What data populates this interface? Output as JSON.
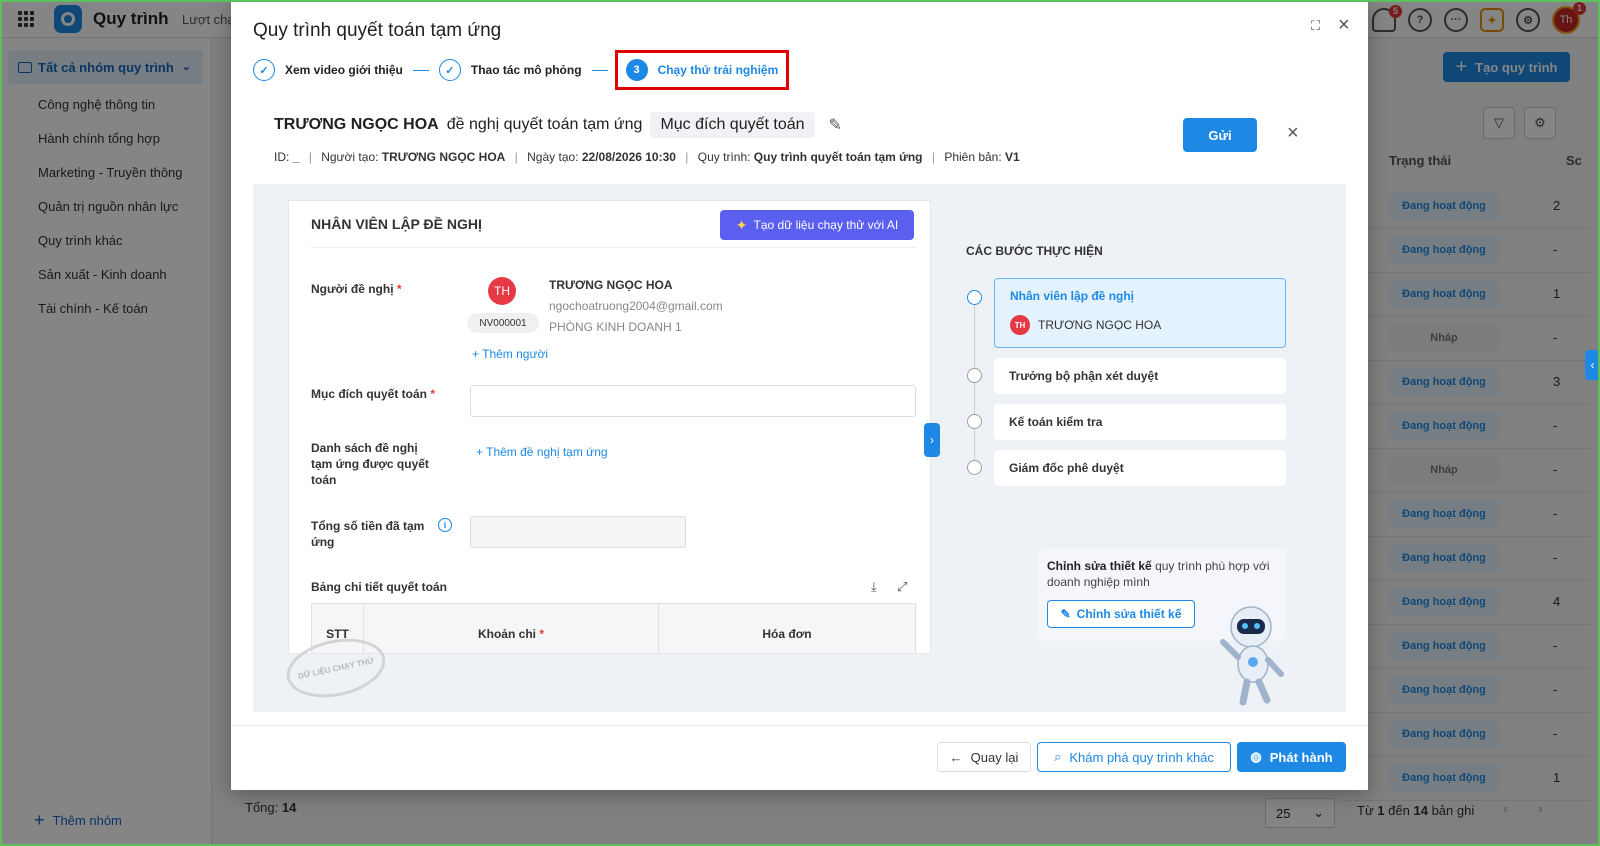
{
  "app": {
    "title": "Quy trình",
    "nav_tab": "Lượt chạ",
    "user_initials": "Th",
    "notif_count": "5",
    "avatar_badge": "1"
  },
  "sidebar": {
    "group_label": "Tất cả nhóm quy trình",
    "items": [
      {
        "label": "Công nghệ thông tin"
      },
      {
        "label": "Hành chính tổng hợp"
      },
      {
        "label": "Marketing - Truyền thông"
      },
      {
        "label": "Quản trị nguồn nhân lực"
      },
      {
        "label": "Quy trình khác"
      },
      {
        "label": "Sản xuất - Kinh doanh"
      },
      {
        "label": "Tài chính - Kế toán"
      }
    ],
    "add_group": "Thêm nhóm"
  },
  "background": {
    "create_button": "Tạo quy trình",
    "col_status": "Trạng thái",
    "col_s": "Sc",
    "rows": [
      {
        "status": "Đang hoạt động",
        "draft": false,
        "count": "2"
      },
      {
        "status": "Đang hoạt động",
        "draft": false,
        "count": "-"
      },
      {
        "status": "Đang hoạt động",
        "draft": false,
        "count": "1"
      },
      {
        "status": "Nháp",
        "draft": true,
        "count": "-"
      },
      {
        "status": "Đang hoạt động",
        "draft": false,
        "count": "3"
      },
      {
        "status": "Đang hoạt động",
        "draft": false,
        "count": "-"
      },
      {
        "status": "Nháp",
        "draft": true,
        "count": "-"
      },
      {
        "status": "Đang hoạt động",
        "draft": false,
        "count": "-"
      },
      {
        "status": "Đang hoạt động",
        "draft": false,
        "count": "-"
      },
      {
        "status": "Đang hoạt động",
        "draft": false,
        "count": "4"
      },
      {
        "status": "Đang hoạt động",
        "draft": false,
        "count": "-"
      },
      {
        "status": "Đang hoạt động",
        "draft": false,
        "count": "-"
      },
      {
        "status": "Đang hoạt động",
        "draft": false,
        "count": "-"
      },
      {
        "status": "Đang hoạt động",
        "draft": false,
        "count": "1"
      }
    ],
    "total_label": "Tổng:",
    "total_value": "14",
    "page_size": "25",
    "page_info_prefix": "Từ",
    "page_info_from": "1",
    "page_info_mid": "đến",
    "page_info_to": "14",
    "page_info_suffix": "bản ghi"
  },
  "modal": {
    "title": "Quy trình quyết toán tạm ứng",
    "steps": [
      {
        "num": "✓",
        "label": "Xem video giới thiệu"
      },
      {
        "num": "✓",
        "label": "Thao tác mô phỏng"
      },
      {
        "num": "3",
        "label": "Chạy thử trải nghiệm"
      }
    ],
    "request": {
      "requester": "TRƯƠNG NGỌC HOA",
      "action": "đề nghị quyết toán tạm ứng",
      "purpose_chip": "Mục đích quyết toán",
      "send_button": "Gửi",
      "meta": {
        "id_label": "ID:",
        "id_value": "_",
        "creator_label": "Người tạo:",
        "creator_value": "TRƯƠNG NGỌC HOA",
        "date_label": "Ngày tạo:",
        "date_value": "22/08/2026 10:30",
        "process_label": "Quy trình:",
        "process_value": "Quy trình quyết toán tạm ứng",
        "version_label": "Phiên bản:",
        "version_value": "V1"
      }
    },
    "form": {
      "title": "NHÂN VIÊN LẬP ĐỀ NGHỊ",
      "ai_button": "Tạo dữ liệu chạy thử với AI",
      "requester_label": "Người đề nghị",
      "employee": {
        "initials": "TH",
        "code": "NV000001",
        "name": "TRƯƠNG NGỌC HOA",
        "email": "ngochoatruong2004@gmail.com",
        "dept": "PHÒNG KINH DOANH 1"
      },
      "add_person": "Thêm người",
      "purpose_label": "Mục đích quyết toán",
      "list_label": "Danh sách đề nghị tạm ứng được quyết toán",
      "add_request": "Thêm đề nghị tạm ứng",
      "total_label": "Tổng số tiền đã tạm ứng",
      "table_label": "Bảng chi tiết quyết toán",
      "columns": {
        "stt": "STT",
        "item": "Khoản chi",
        "invoice": "Hóa đơn"
      },
      "stamp": "DỮ LIỆU CHẠY THỬ"
    },
    "flow": {
      "title": "CÁC BƯỚC THỰC HIỆN",
      "steps": [
        {
          "label": "Nhân viên lập đề nghị",
          "assignee": "TRƯƠNG NGỌC HOA",
          "assignee_initials": "TH"
        },
        {
          "label": "Trưởng bộ phận xét duyệt"
        },
        {
          "label": "Kế toán kiểm tra"
        },
        {
          "label": "Giám đốc phê duyệt"
        }
      ]
    },
    "promo": {
      "bold": "Chỉnh sửa thiết kế",
      "rest": "quy trình phù hợp với doanh nghiệp mình",
      "button": "Chỉnh sửa thiết kế"
    },
    "footer": {
      "back": "Quay lại",
      "explore": "Khám phá quy trình khác",
      "publish": "Phát hành"
    }
  }
}
